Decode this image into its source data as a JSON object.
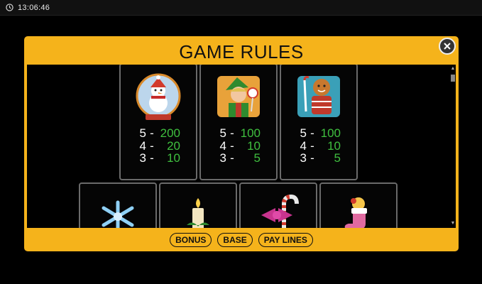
{
  "status_bar": {
    "time": "13:06:46",
    "icon": "clock-icon"
  },
  "modal": {
    "title": "GAME RULES",
    "close_icon": "close-icon",
    "accent": "#f5b31b",
    "win_color": "#3fbf3f",
    "cards": [
      {
        "symbol": "snowman-snowglobe-icon",
        "pays": [
          {
            "count": "5",
            "dash": "-",
            "value": "200"
          },
          {
            "count": "4",
            "dash": "-",
            "value": "20"
          },
          {
            "count": "3",
            "dash": "-",
            "value": "10"
          }
        ]
      },
      {
        "symbol": "elf-icon",
        "pays": [
          {
            "count": "5",
            "dash": "-",
            "value": "100"
          },
          {
            "count": "4",
            "dash": "-",
            "value": "10"
          },
          {
            "count": "3",
            "dash": "-",
            "value": "5"
          }
        ]
      },
      {
        "symbol": "gingerbread-man-icon",
        "pays": [
          {
            "count": "5",
            "dash": "-",
            "value": "100"
          },
          {
            "count": "4",
            "dash": "-",
            "value": "10"
          },
          {
            "count": "3",
            "dash": "-",
            "value": "5"
          }
        ]
      }
    ],
    "lower_cards": [
      {
        "symbol": "snowflake-icon"
      },
      {
        "symbol": "candle-icon"
      },
      {
        "symbol": "candy-cane-bow-icon"
      },
      {
        "symbol": "stocking-icon"
      }
    ],
    "tabs": [
      {
        "label": "BONUS"
      },
      {
        "label": "BASE"
      },
      {
        "label": "PAY LINES"
      }
    ]
  }
}
